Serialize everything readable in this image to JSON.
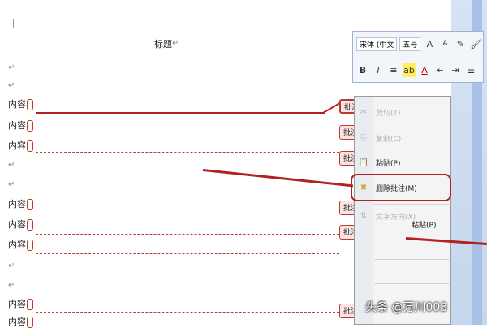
{
  "document": {
    "title": "标题",
    "lines": [
      "内容",
      "内容",
      "内容",
      "内容",
      "内容",
      "内容",
      "内容",
      "内容"
    ],
    "balloon_label": "批注"
  },
  "mini_toolbar": {
    "font_name": "宋体 (中文",
    "font_size": "五号",
    "grow_font": "A",
    "shrink_font": "A",
    "bold": "B",
    "italic": "I",
    "font_color": "A"
  },
  "context_menu": {
    "cut": "剪切(T)",
    "copy": "复制(C)",
    "paste": "粘贴(P)",
    "delete_comment": "删除批注(M)",
    "text_direction": "文字方向(X)",
    "paste_small": "粘贴(P)"
  },
  "watermark": "头条 @万川003",
  "colors": {
    "accent_red": "#b22222",
    "balloon_fill": "#fbe3e3"
  }
}
